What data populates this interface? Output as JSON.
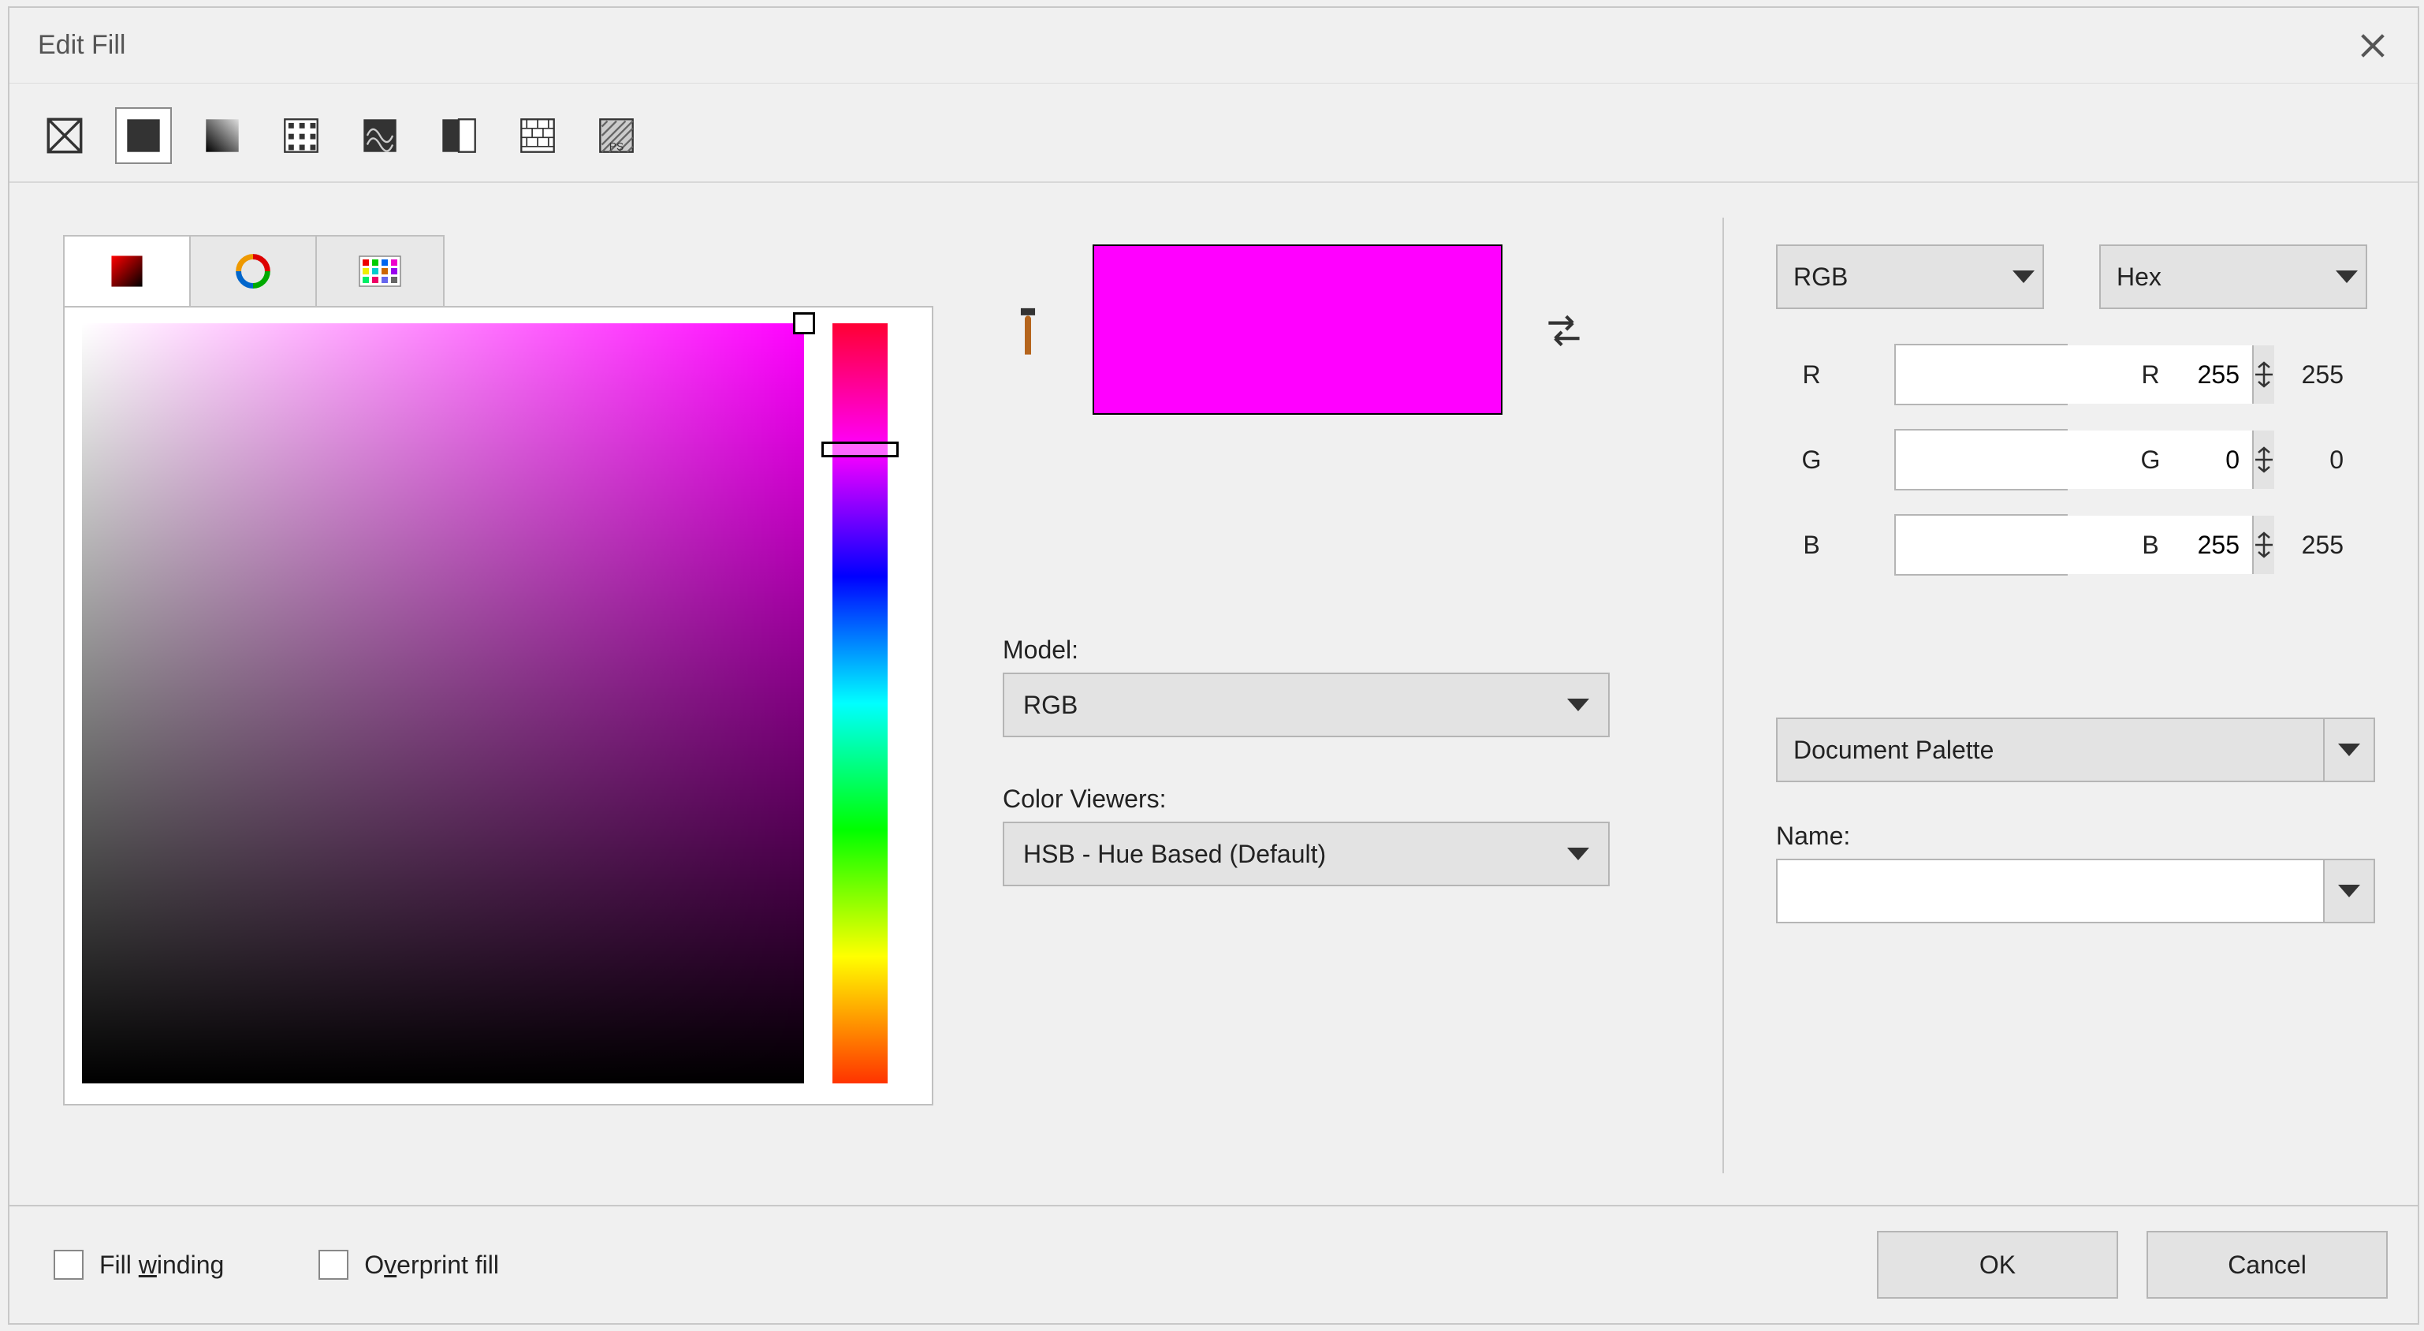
{
  "dialog": {
    "title": "Edit Fill"
  },
  "fill_types": {
    "none": "no-fill-icon",
    "solid": "solid-fill-icon",
    "fountain": "fountain-fill-icon",
    "pattern": "vector-pattern-icon",
    "texture": "texture-fill-icon",
    "twocolor": "two-color-pattern-icon",
    "bitmap": "bitmap-pattern-icon",
    "postscript": "postscript-fill-icon"
  },
  "picker": {
    "current_color": "#ff00ff"
  },
  "model": {
    "label": "Model:",
    "value": "RGB"
  },
  "color_viewers": {
    "label": "Color Viewers:",
    "value": "HSB - Hue Based (Default)"
  },
  "channels_left": {
    "mode": "RGB",
    "r_label": "R",
    "g_label": "G",
    "b_label": "B",
    "r": "255",
    "g": "0",
    "b": "255"
  },
  "channels_right": {
    "mode": "Hex",
    "r_label": "R",
    "g_label": "G",
    "b_label": "B",
    "r": "255",
    "g": "0",
    "b": "255"
  },
  "palette": {
    "value": "Document Palette",
    "name_label": "Name:",
    "name_value": ""
  },
  "footer": {
    "fill_winding": "Fill winding",
    "overprint_fill": "Overprint fill",
    "ok": "OK",
    "cancel": "Cancel"
  }
}
